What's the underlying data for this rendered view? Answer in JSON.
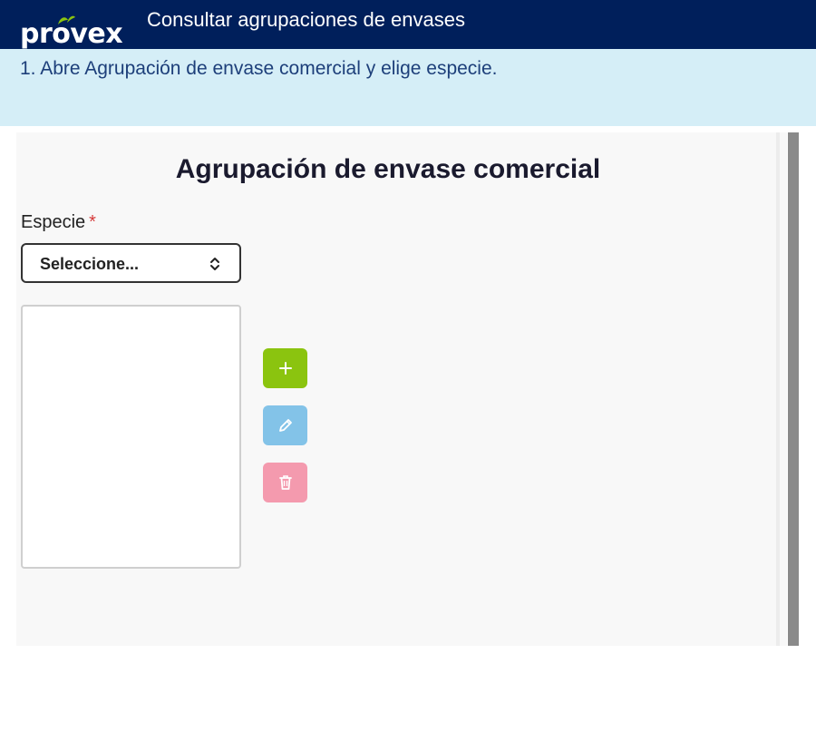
{
  "header": {
    "logo_text": "provex",
    "title": "Consultar agrupaciones de envases"
  },
  "instruction": {
    "text": "1. Abre Agrupación de envase comercial y elige especie."
  },
  "form": {
    "title": "Agrupación de envase comercial",
    "especie": {
      "label": "Especie",
      "required_mark": "*",
      "selected_value": "Seleccione..."
    },
    "list_items": [],
    "actions": {
      "add_icon": "plus-icon",
      "edit_icon": "pencil-icon",
      "delete_icon": "trash-icon"
    }
  },
  "colors": {
    "header_bg": "#001f5b",
    "instruction_bg": "#d5eef7",
    "instruction_text": "#1d3f7a",
    "logo_leaf": "#8bc40f",
    "add_button": "#8bc40f",
    "edit_button": "#83c3e8",
    "delete_button": "#f49aae",
    "required_mark": "#d63b3b"
  }
}
